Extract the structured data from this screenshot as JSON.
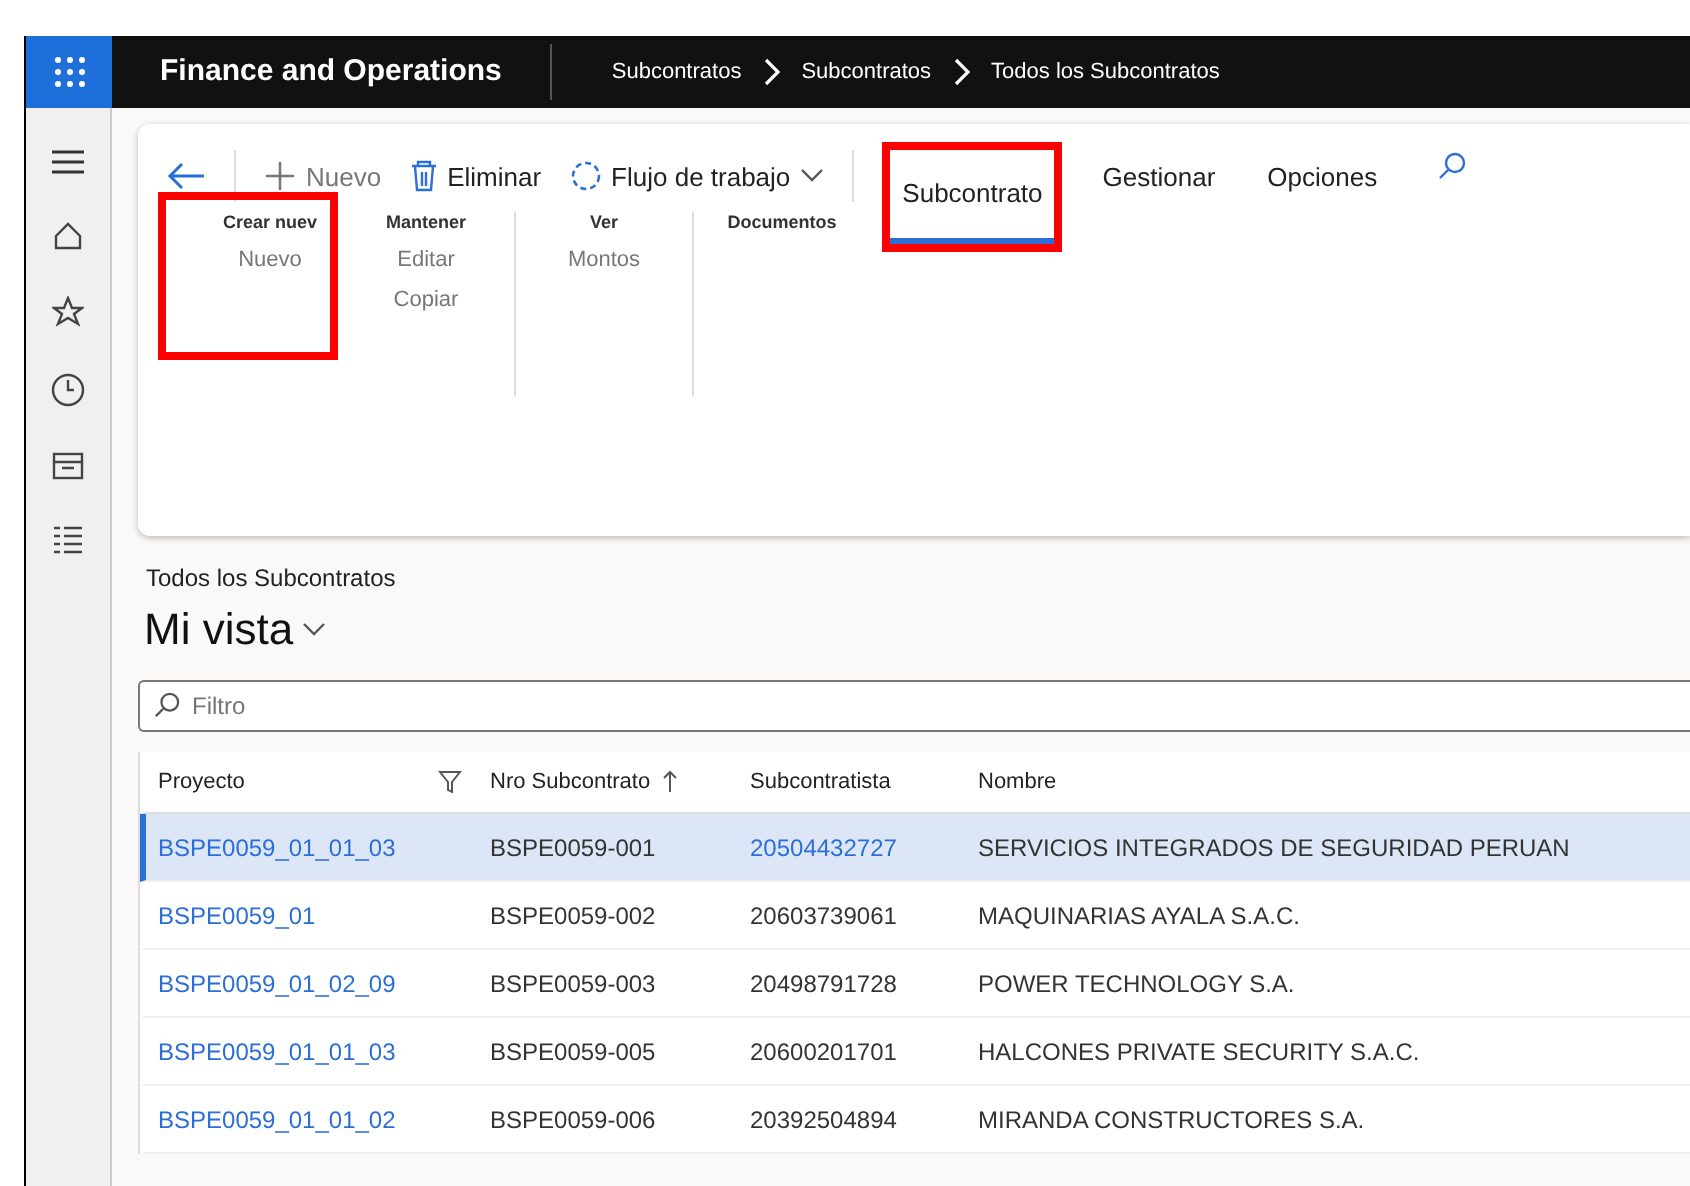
{
  "app_bar": {
    "title": "Finance and Operations",
    "breadcrumbs": [
      "Subcontratos",
      "Subcontratos",
      "Todos los Subcontratos"
    ]
  },
  "action_bar": {
    "items": [
      {
        "label": "Nuevo",
        "kind": "new",
        "disabled": true
      },
      {
        "label": "Eliminar",
        "kind": "delete",
        "disabled": false
      },
      {
        "label": "Flujo de trabajo",
        "kind": "workflow",
        "disabled": false
      }
    ],
    "tabs": [
      {
        "label": "Subcontrato",
        "selected": true,
        "highlighted": true
      },
      {
        "label": "Gestionar",
        "selected": false,
        "highlighted": false
      },
      {
        "label": "Opciones",
        "selected": false,
        "highlighted": false
      }
    ]
  },
  "groups": [
    {
      "title": "Crear nuev",
      "highlighted": true,
      "actions": [
        "Nuevo"
      ]
    },
    {
      "title": "Mantener",
      "highlighted": false,
      "actions": [
        "Editar",
        "Copiar"
      ]
    },
    {
      "title": "Ver",
      "highlighted": false,
      "actions": [
        "Montos"
      ]
    },
    {
      "title": "Documentos",
      "highlighted": false
    }
  ],
  "page": {
    "caption": "Todos los Subcontratos",
    "view": "Mi vista"
  },
  "filter": {
    "placeholder": "Filtro"
  },
  "table": {
    "columns": [
      "Proyecto",
      "Nro Subcontrato",
      "Subcontratista",
      "Nombre"
    ],
    "rows": [
      {
        "cells": [
          "BSPE0059_01_01_03",
          "BSPE0059-001",
          "20504432727",
          "SERVICIOS INTEGRADOS DE SEGURIDAD PERUAN"
        ],
        "selected": true
      },
      {
        "cells": [
          "BSPE0059_01",
          "BSPE0059-002",
          "20603739061",
          "MAQUINARIAS AYALA S.A.C."
        ],
        "selected": false
      },
      {
        "cells": [
          "BSPE0059_01_02_09",
          "BSPE0059-003",
          "20498791728",
          "POWER TECHNOLOGY S.A."
        ],
        "selected": false
      },
      {
        "cells": [
          "BSPE0059_01_01_03",
          "BSPE0059-005",
          "20600201701",
          "HALCONES PRIVATE SECURITY S.A.C."
        ],
        "selected": false
      },
      {
        "cells": [
          "BSPE0059_01_01_02",
          "BSPE0059-006",
          "20392504894",
          "MIRANDA CONSTRUCTORES S.A."
        ],
        "selected": false
      }
    ]
  }
}
